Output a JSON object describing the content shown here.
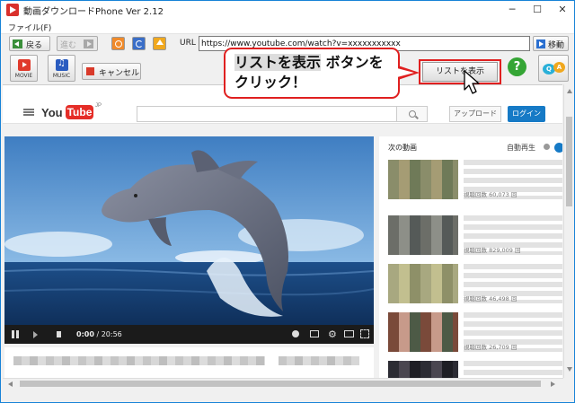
{
  "window": {
    "title": "動画ダウンロードPhone Ver 2.12",
    "controls": {
      "minimize": "─",
      "maximize": "☐",
      "close": "✕"
    }
  },
  "menu": {
    "file": "ファイル(F)"
  },
  "nav": {
    "back_label": "戻る",
    "forward_label": "進む",
    "url_label": "URL",
    "url_value": "https://www.youtube.com/watch?v=xxxxxxxxxxx",
    "go_label": "移動"
  },
  "toolbar": {
    "movie_label": "MOVIE",
    "music_label": "MUSIC",
    "cancel_label": "キャンセル",
    "list_button_label": "リストを表示",
    "help_label": "?",
    "qa_q": "Q",
    "qa_a": "A"
  },
  "callout": {
    "line1_highlight": "リストを表示",
    "line1_rest": " ボタンを",
    "line2": "クリック！"
  },
  "youtube": {
    "logo_you": "You",
    "logo_tube": "Tube",
    "logo_region": "JP",
    "upload_label": "アップロード",
    "login_label": "ログイン",
    "player": {
      "time_current": "0:00",
      "time_separator": " / ",
      "time_total": "20:56"
    },
    "sidebar": {
      "next_label": "次の動画",
      "autoplay_label": "自動再生",
      "items": [
        {
          "views": "視聴回数 60,073 回"
        },
        {
          "views": "視聴回数 829,009 回"
        },
        {
          "views": "視聴回数 46,498 回"
        },
        {
          "views": "視聴回数 26,709 回"
        },
        {
          "views": ""
        }
      ]
    }
  },
  "colors": {
    "accent_red": "#e02020",
    "youtube_red": "#e52d27",
    "login_blue": "#167ac6"
  },
  "icons": {
    "back": "arrow-left-icon",
    "forward": "arrow-right-icon",
    "stop": "stop-icon",
    "reload": "reload-icon",
    "home": "home-icon",
    "go": "go-arrow-icon",
    "movie": "movie-icon",
    "music": "music-icon",
    "help": "help-icon",
    "qa": "qa-icon",
    "search": "search-icon"
  }
}
